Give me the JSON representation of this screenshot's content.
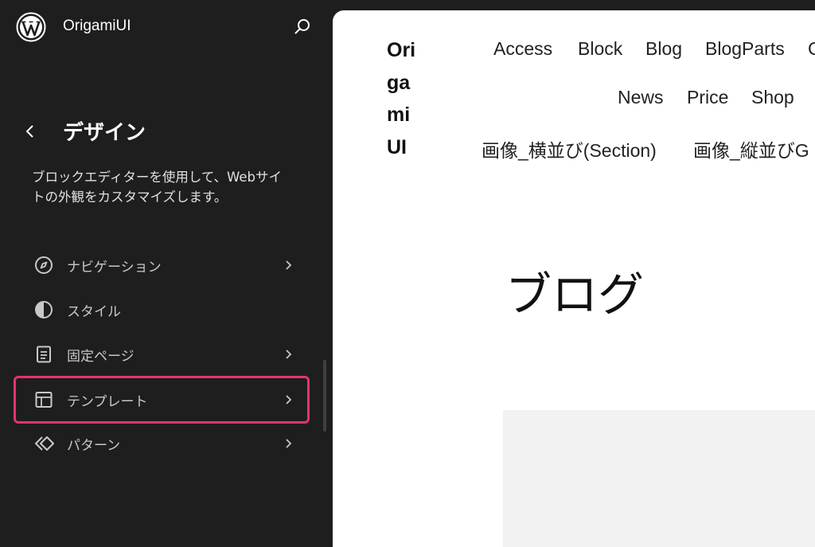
{
  "site": {
    "name": "OrigamiUI"
  },
  "panel": {
    "title": "デザイン",
    "description": "ブロックエディターを使用して、Webサイトの外観をカスタマイズします。"
  },
  "nav": {
    "items": [
      {
        "label": "ナビゲーション",
        "icon": "compass-icon",
        "has_chevron": true
      },
      {
        "label": "スタイル",
        "icon": "half-circle-icon",
        "has_chevron": false
      },
      {
        "label": "固定ページ",
        "icon": "page-icon",
        "has_chevron": true
      },
      {
        "label": "テンプレート",
        "icon": "layout-icon",
        "has_chevron": true,
        "highlighted": true
      },
      {
        "label": "パターン",
        "icon": "symbol-icon",
        "has_chevron": true
      }
    ]
  },
  "preview": {
    "logo_text": "Origami UI",
    "logo_lines": [
      "Ori",
      "ga",
      "mi",
      "UI"
    ],
    "menu": {
      "row1": [
        "Access",
        "Block",
        "Blog",
        "BlogParts",
        "C"
      ],
      "row2": [
        "News",
        "Price",
        "Shop"
      ],
      "row3": [
        "画像_横並び(Section)",
        "画像_縦並びG"
      ]
    },
    "heading": "ブログ"
  },
  "colors": {
    "sidebar_bg": "#1e1e1e",
    "highlight": "#e5336b",
    "preview_bg": "#ffffff"
  }
}
